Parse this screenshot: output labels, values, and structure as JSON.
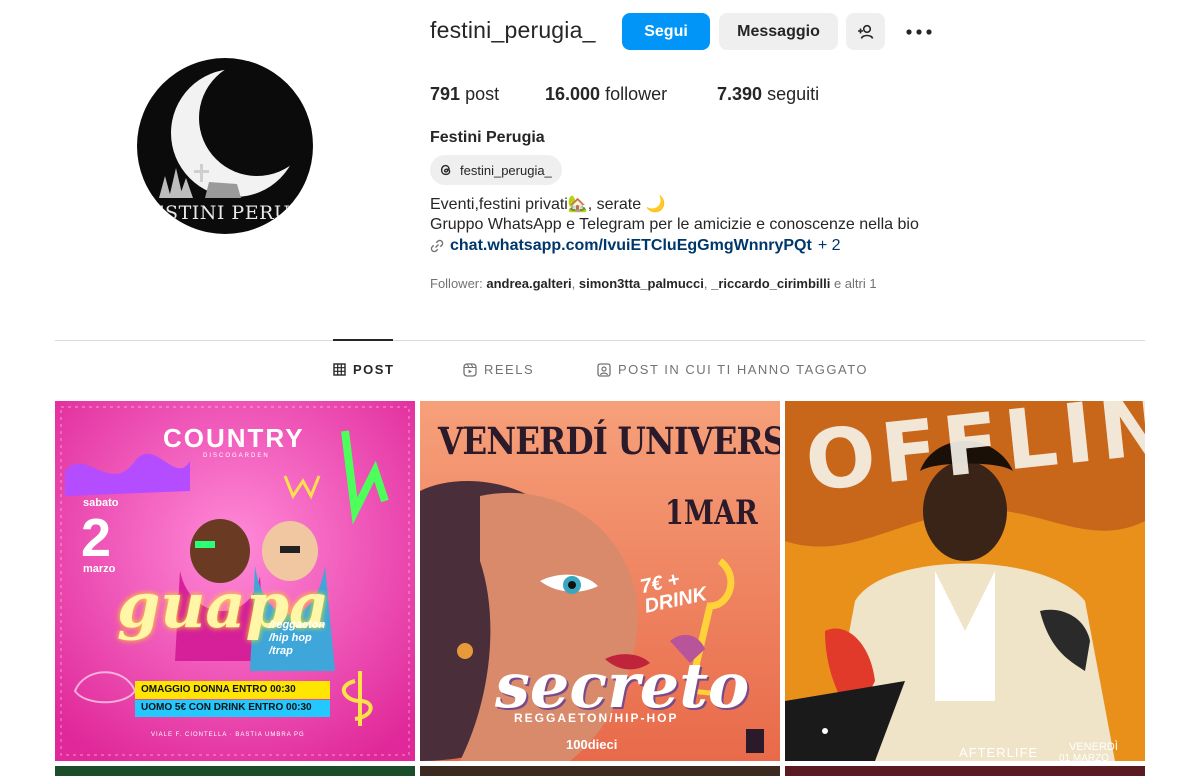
{
  "profile": {
    "username": "festini_perugia_",
    "avatar_text": "FESTINI PERUGIA",
    "follow_label": "Segui",
    "message_label": "Messaggio",
    "posts_count": "791",
    "posts_label": "post",
    "followers_count": "16.000",
    "followers_label": "follower",
    "following_count": "7.390",
    "following_label": "seguiti",
    "full_name": "Festini Perugia",
    "threads_handle": "festini_perugia_",
    "bio_line1": "Eventi,festini privati🏡, serate 🌙",
    "bio_line2": "Gruppo WhatsApp e Telegram per le amicizie e conoscenze nella bio",
    "bio_link": "chat.whatsapp.com/IvuiETCluEgGmgWnnryPQt",
    "bio_link_more": "+ 2",
    "followed_by_prefix": "Follower:",
    "followed_by": [
      "andrea.galteri",
      "simon3tta_palmucci",
      "_riccardo_cirimbilli"
    ],
    "followed_by_suffix": "e altri 1"
  },
  "tabs": [
    {
      "label": "POST",
      "active": true
    },
    {
      "label": "REELS",
      "active": false
    },
    {
      "label": "POST IN CUI TI HANNO TAGGATO",
      "active": false
    }
  ],
  "posts": [
    {
      "venue": "COUNTRY",
      "venue_sub": "DISCOGARDEN",
      "day_label": "sabato",
      "day_number": "2",
      "month": "marzo",
      "title": "guapa",
      "genres": [
        "/reggaeton",
        "/hip hop",
        "/trap"
      ],
      "promo1": "OMAGGIO DONNA ENTRO 00:30",
      "promo2": "UOMO 5€ CON DRINK ENTRO 00:30",
      "address": "VIALE F. CIONTELLA · BASTIA UMBRA PG"
    },
    {
      "headline": "VENERDÍ UNIVERSITARIO",
      "date": "1MAR",
      "price": "7€ + DRINK",
      "title": "secreto",
      "subtitle": "REGGAETON/HIP-HOP",
      "brand": "100dieci"
    },
    {
      "headline": "OFFLINE",
      "footer_left": "AFTERLIFE",
      "footer_right": "VENERDÌ",
      "footer_date": "01 MARZO"
    }
  ],
  "colors": {
    "accent": "#0095f6",
    "link": "#00376b",
    "secondary_button": "#efefef"
  },
  "icons": [
    "add-user-icon",
    "more-icon",
    "threads-icon",
    "link-icon",
    "grid-icon",
    "reels-icon",
    "tagged-icon"
  ]
}
